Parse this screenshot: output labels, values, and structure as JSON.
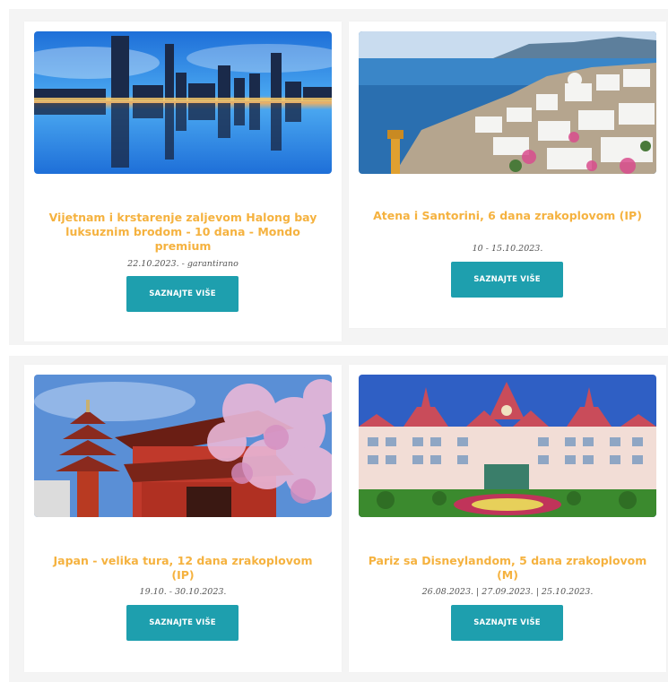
{
  "cards": [
    {
      "title": "Vijetnam i krstarenje zaljevom Halong bay luksuznim brodom - 10 dana - Mondo premium",
      "date": "22.10.2023. - garantirano",
      "button": "SAZNAJTE VIŠE",
      "image": "vietnam-city-skyline-image"
    },
    {
      "title": "Atena i Santorini, 6 dana zrakoplovom (IP)",
      "date": "10 - 15.10.2023.",
      "button": "SAZNAJTE VIŠE",
      "image": "santorini-village-image"
    },
    {
      "title": "Japan - velika tura, 12 dana zrakoplovom (IP)",
      "date": "19.10. - 30.10.2023.",
      "button": "SAZNAJTE VIŠE",
      "image": "japan-temple-blossom-image"
    },
    {
      "title": "Pariz sa Disneylandom, 5 dana zrakoplovom (M)",
      "date": "26.08.2023. | 27.09.2023. | 25.10.2023.",
      "button": "SAZNAJTE VIŠE",
      "image": "disneyland-hotel-image"
    }
  ],
  "colors": {
    "title": "#f5b23f",
    "button": "#1e9fae",
    "section_bg": "#f4f4f4"
  }
}
